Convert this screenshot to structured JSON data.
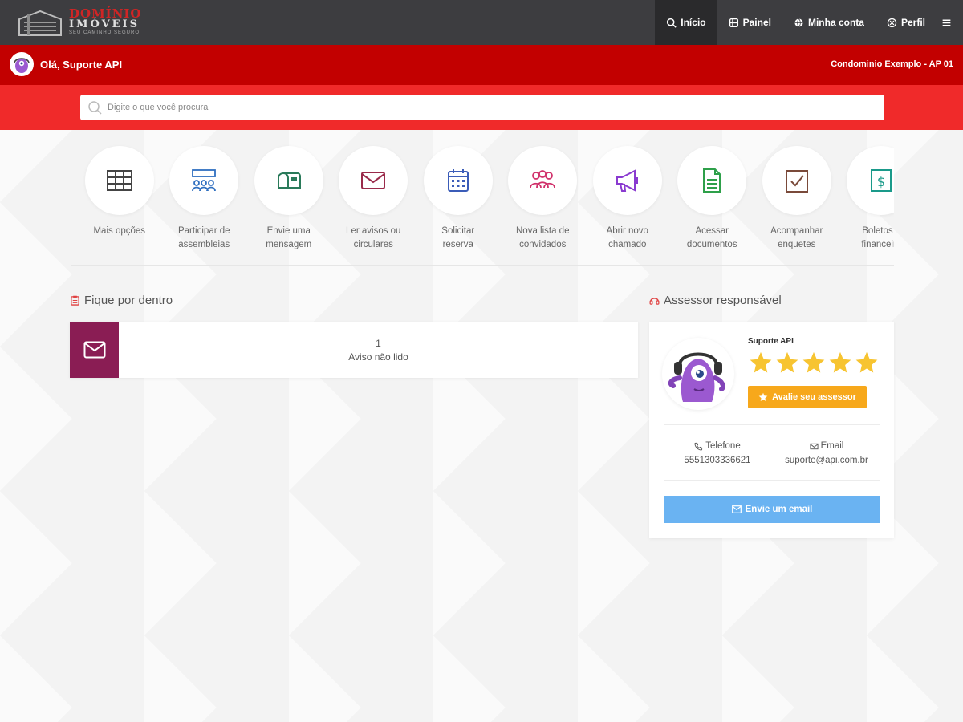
{
  "app": {
    "logo_title": "DOMÍNIO",
    "logo_subtitle": "IMÓVEIS",
    "logo_tagline": "SEU CAMINHO SEGURO"
  },
  "nav": {
    "items": [
      {
        "label": "Início",
        "icon": "search-icon",
        "active": true
      },
      {
        "label": "Painel",
        "icon": "dashboard-icon",
        "active": false
      },
      {
        "label": "Minha conta",
        "icon": "globe-icon",
        "active": false
      },
      {
        "label": "Perfil",
        "icon": "user-circle-icon",
        "active": false
      }
    ],
    "menu_icon": "hamburger-icon"
  },
  "greeting": {
    "text": "Olá, Suporte API",
    "unit": "Condominio Exemplo - AP 01"
  },
  "search": {
    "placeholder": "Digite o que você procura"
  },
  "shortcuts": [
    {
      "label": "Mais opções",
      "icon": "grid-icon",
      "color": "#444444"
    },
    {
      "label": "Participar de\nassembleias",
      "icon": "meeting-icon",
      "color": "#2f6fc0"
    },
    {
      "label": "Envie uma\nmensagem",
      "icon": "mailbox-icon",
      "color": "#2a7a5a"
    },
    {
      "label": "Ler avisos ou\ncirculares",
      "icon": "envelope-icon",
      "color": "#9a2a4a"
    },
    {
      "label": "Solicitar\nreserva",
      "icon": "calendar-icon",
      "color": "#3b5cb8"
    },
    {
      "label": "Nova lista de\nconvidados",
      "icon": "group-icon",
      "color": "#d0306a"
    },
    {
      "label": "Abrir novo\nchamado",
      "icon": "megaphone-icon",
      "color": "#8a3ad0"
    },
    {
      "label": "Acessar\ndocumentos",
      "icon": "document-icon",
      "color": "#2ea04a"
    },
    {
      "label": "Acompanhar\nenquetes",
      "icon": "checkbox-icon",
      "color": "#7a4a3a"
    },
    {
      "label": "Boletos e\nfinanceiro",
      "icon": "dollar-icon",
      "color": "#1a9a8a"
    }
  ],
  "updates": {
    "title": "Fique por dentro",
    "notice_count": "1",
    "notice_label": "Aviso não lido"
  },
  "advisor": {
    "title": "Assessor responsável",
    "name": "Suporte API",
    "rating_stars": 5,
    "rate_button": "Avalie seu assessor",
    "phone_label": "Telefone",
    "phone": "5551303336621",
    "email_label": "Email",
    "email": "suporte@api.com.br",
    "email_button": "Envie um email"
  },
  "colors": {
    "topbar": "#3d3d40",
    "greeting_bar": "#c20000",
    "search_bar": "#f02a2a",
    "notice_accent": "#8a1d54",
    "star": "#f7c431",
    "rate_button": "#f7a81b",
    "email_button": "#6ab3f2"
  }
}
